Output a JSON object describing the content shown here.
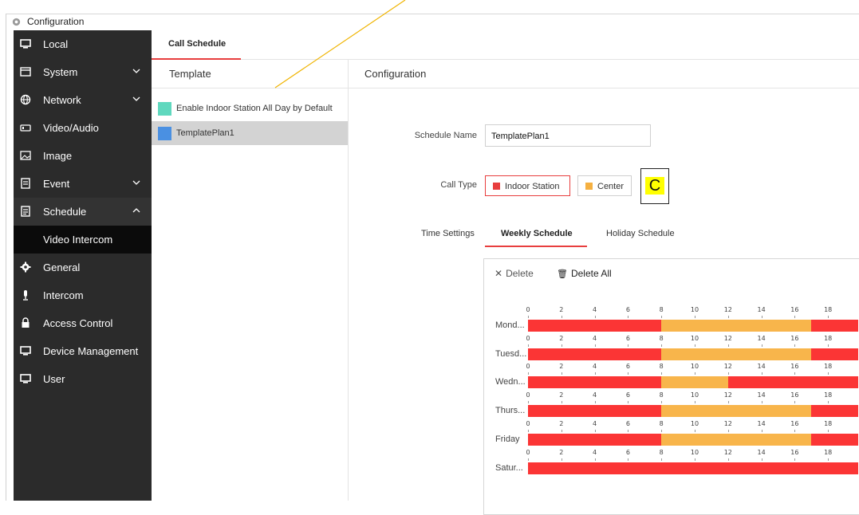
{
  "window": {
    "title": "Configuration"
  },
  "sidebar": {
    "items": [
      {
        "label": "Local",
        "icon": "monitor-icon",
        "chevron": ""
      },
      {
        "label": "System",
        "icon": "window-icon",
        "chevron": "down"
      },
      {
        "label": "Network",
        "icon": "globe-icon",
        "chevron": "down"
      },
      {
        "label": "Video/Audio",
        "icon": "video-icon",
        "chevron": ""
      },
      {
        "label": "Image",
        "icon": "image-icon",
        "chevron": ""
      },
      {
        "label": "Event",
        "icon": "event-icon",
        "chevron": "down"
      },
      {
        "label": "Schedule",
        "icon": "calendar-icon",
        "chevron": "up"
      },
      {
        "label": "General",
        "icon": "gear-icon",
        "chevron": ""
      },
      {
        "label": "Intercom",
        "icon": "microphone-icon",
        "chevron": ""
      },
      {
        "label": "Access Control",
        "icon": "lock-icon",
        "chevron": ""
      },
      {
        "label": "Device Management",
        "icon": "monitor-icon",
        "chevron": ""
      },
      {
        "label": "User",
        "icon": "monitor-icon",
        "chevron": ""
      }
    ],
    "sub_item": "Video Intercom"
  },
  "tabs": {
    "active": "Call Schedule"
  },
  "template_panel": {
    "title": "Template",
    "items": [
      {
        "label": "Enable Indoor Station All Day by Default",
        "color": "#5fd8be"
      },
      {
        "label": "TemplatePlan1",
        "color": "#4a90e2"
      }
    ]
  },
  "config": {
    "title": "Configuration",
    "schedule_name_label": "Schedule Name",
    "schedule_name_value": "TemplatePlan1",
    "call_type_label": "Call Type",
    "call_types": [
      {
        "label": "Indoor Station",
        "color": "#e83e3e",
        "selected": true
      },
      {
        "label": "Center",
        "color": "#f5b041",
        "selected": false
      }
    ],
    "annotation_letter": "C",
    "time_settings_label": "Time Settings",
    "time_tabs": [
      "Weekly Schedule",
      "Holiday Schedule"
    ],
    "delete_label": "Delete",
    "delete_all_label": "Delete All"
  },
  "schedule": {
    "ticks": [
      "0",
      "2",
      "4",
      "6",
      "8",
      "10",
      "12",
      "14",
      "16",
      "18",
      ":"
    ],
    "days": [
      {
        "label": "Mond...",
        "segments": [
          {
            "from": 0,
            "to": 8,
            "type": "indoor"
          },
          {
            "from": 8,
            "to": 17,
            "type": "center"
          },
          {
            "from": 17,
            "to": 24,
            "type": "indoor"
          }
        ]
      },
      {
        "label": "Tuesd...",
        "segments": [
          {
            "from": 0,
            "to": 8,
            "type": "indoor"
          },
          {
            "from": 8,
            "to": 17,
            "type": "center"
          },
          {
            "from": 17,
            "to": 24,
            "type": "indoor"
          }
        ]
      },
      {
        "label": "Wedn...",
        "segments": [
          {
            "from": 0,
            "to": 8,
            "type": "indoor"
          },
          {
            "from": 8,
            "to": 12,
            "type": "center"
          },
          {
            "from": 12,
            "to": 24,
            "type": "indoor"
          }
        ]
      },
      {
        "label": "Thurs...",
        "segments": [
          {
            "from": 0,
            "to": 8,
            "type": "indoor"
          },
          {
            "from": 8,
            "to": 17,
            "type": "center"
          },
          {
            "from": 17,
            "to": 24,
            "type": "indoor"
          }
        ]
      },
      {
        "label": "Friday",
        "segments": [
          {
            "from": 0,
            "to": 8,
            "type": "indoor"
          },
          {
            "from": 8,
            "to": 17,
            "type": "center"
          },
          {
            "from": 17,
            "to": 24,
            "type": "indoor"
          }
        ]
      },
      {
        "label": "Satur...",
        "segments": [
          {
            "from": 0,
            "to": 24,
            "type": "indoor"
          }
        ]
      }
    ],
    "colors": {
      "indoor": "#fb3535",
      "center": "#f8b54b"
    }
  }
}
